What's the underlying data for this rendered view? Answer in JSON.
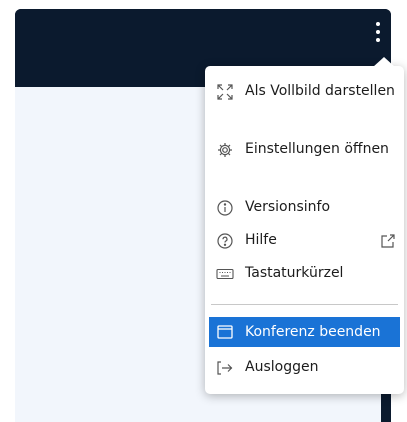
{
  "menu": {
    "items": [
      {
        "label": "Als Vollbild darstellen",
        "icon": "fullscreen-icon"
      },
      {
        "label": "Einstellungen öffnen",
        "icon": "gear-icon"
      },
      {
        "label": "Versionsinfo",
        "icon": "info-icon"
      },
      {
        "label": "Hilfe",
        "icon": "help-icon"
      },
      {
        "label": "Tastaturkürzel",
        "icon": "keyboard-icon"
      },
      {
        "label": "Konferenz beenden",
        "icon": "window-icon"
      },
      {
        "label": "Ausloggen",
        "icon": "logout-icon"
      }
    ]
  },
  "colors": {
    "header": "#0b1a2e",
    "content": "#f2f6fc",
    "accent": "#1a73d6"
  }
}
